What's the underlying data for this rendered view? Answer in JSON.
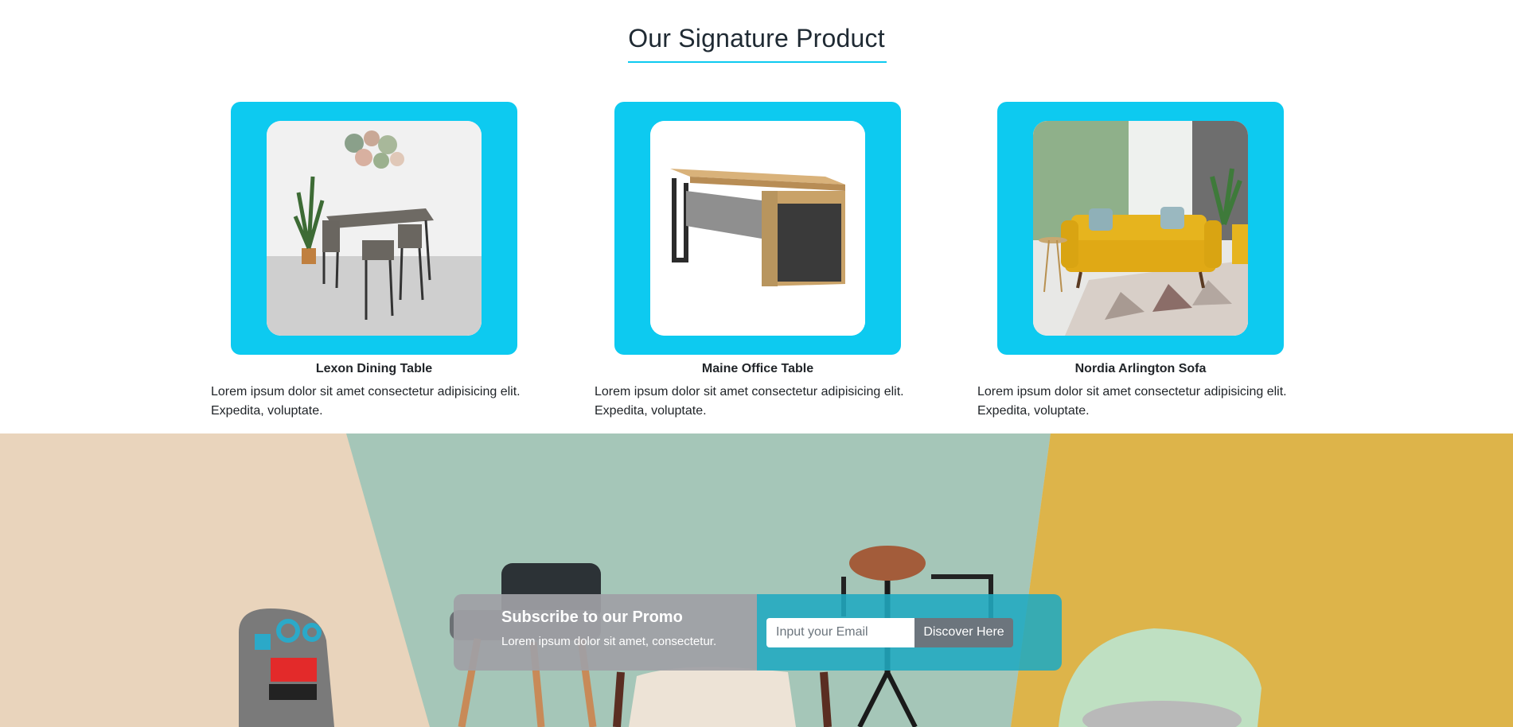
{
  "section": {
    "title": "Our Signature Product"
  },
  "products": [
    {
      "name": "Lexon Dining Table",
      "description": "Lorem ipsum dolor sit amet consectetur adipisicing elit. Expedita, voluptate.",
      "image_icon": "dining-table-photo"
    },
    {
      "name": "Maine Office Table",
      "description": "Lorem ipsum dolor sit amet consectetur adipisicing elit. Expedita, voluptate.",
      "image_icon": "office-desk-photo"
    },
    {
      "name": "Nordia Arlington Sofa",
      "description": "Lorem ipsum dolor sit amet consectetur adipisicing elit. Expedita, voluptate.",
      "image_icon": "yellow-sofa-photo"
    }
  ],
  "promo": {
    "title": "Subscribe to our Promo",
    "subtitle": "Lorem ipsum dolor sit amet, consectetur.",
    "email_placeholder": "Input your Email",
    "button_label": "Discover Here"
  },
  "colors": {
    "accent": "#0dcaf0",
    "button": "#6c757d"
  }
}
